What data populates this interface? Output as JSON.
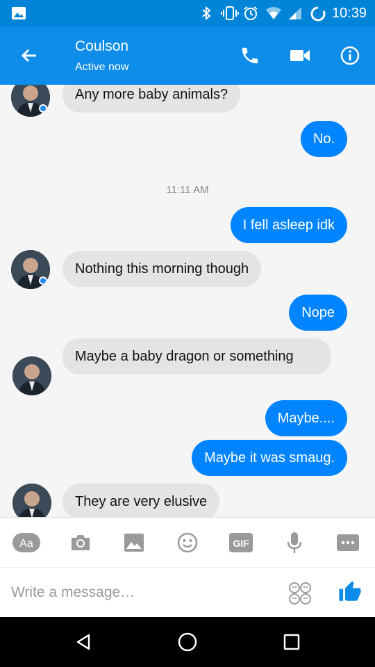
{
  "status_bar": {
    "time": "10:39",
    "icons": [
      "image-icon",
      "bluetooth-icon",
      "vibrate-icon",
      "alarm-icon",
      "wifi-icon",
      "signal-icon",
      "battery-icon"
    ]
  },
  "header": {
    "contact_name": "Coulson",
    "contact_status": "Active now",
    "actions": [
      "back-icon",
      "phone-icon",
      "video-icon",
      "info-icon"
    ]
  },
  "messages": [
    {
      "from": "them",
      "text": "Any more baby animals?"
    },
    {
      "from": "me",
      "text": "No."
    },
    {
      "type": "timestamp",
      "text": "11:11 AM"
    },
    {
      "from": "me",
      "text": "I fell asleep idk"
    },
    {
      "from": "them",
      "text": "Nothing this morning though"
    },
    {
      "from": "me",
      "text": "Nope"
    },
    {
      "from": "them",
      "text": "Maybe a baby dragon or something"
    },
    {
      "from": "me",
      "text": "Maybe...."
    },
    {
      "from": "me",
      "text": "Maybe it was smaug."
    },
    {
      "from": "them",
      "text": "They are very elusive"
    }
  ],
  "toolbar": {
    "text_format_label": "Aa",
    "gif_label": "GIF",
    "tools": [
      "text-format",
      "camera",
      "gallery",
      "emoji",
      "gif",
      "microphone",
      "more"
    ]
  },
  "composer": {
    "placeholder": "Write a message…"
  },
  "colors": {
    "header": "#0d8cea",
    "status_bar": "#0084d8",
    "outgoing_bubble": "#0084ff",
    "incoming_bubble": "#e4e4e4",
    "icon_gray": "#9a9a9a"
  }
}
